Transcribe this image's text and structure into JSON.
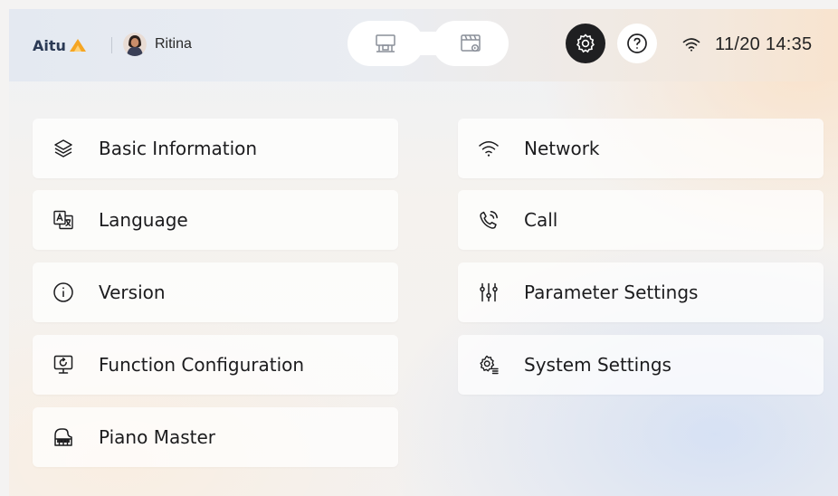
{
  "header": {
    "brand": "Aitu",
    "user_name": "Ritina",
    "mode_switch": [
      {
        "icon": "teaching-desk-icon"
      },
      {
        "icon": "video-playback-icon"
      }
    ],
    "settings_icon": "gear-icon",
    "help_icon": "question-icon",
    "wifi_icon": "wifi-icon",
    "datetime": "11/20 14:35"
  },
  "menu": {
    "left": [
      {
        "label": "Basic Information",
        "icon": "layers-icon"
      },
      {
        "label": "Language",
        "icon": "translate-icon"
      },
      {
        "label": "Version",
        "icon": "info-icon"
      },
      {
        "label": "Function Configuration",
        "icon": "monitor-refresh-icon"
      },
      {
        "label": "Piano Master",
        "icon": "piano-icon"
      }
    ],
    "right": [
      {
        "label": "Network",
        "icon": "wifi-icon"
      },
      {
        "label": "Call",
        "icon": "phone-call-icon"
      },
      {
        "label": "Parameter Settings",
        "icon": "sliders-icon"
      },
      {
        "label": "System Settings",
        "icon": "gear-list-icon"
      }
    ]
  },
  "colors": {
    "accent_orange": "#f5a623",
    "dark_button": "#1f1f21",
    "text": "#1c1c1e"
  }
}
